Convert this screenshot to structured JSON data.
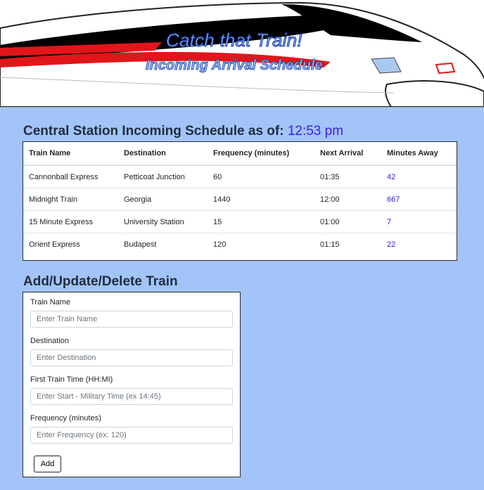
{
  "header": {
    "title": "Catch that Train!",
    "subtitle": "Incoming Arrival Schedule"
  },
  "schedule": {
    "heading": "Central Station Incoming Schedule as of:",
    "current_time": "12:53 pm",
    "columns": [
      "Train Name",
      "Destination",
      "Frequency (minutes)",
      "Next Arrival",
      "Minutes Away"
    ],
    "rows": [
      [
        "Cannonball Express",
        "Petticoat Junction",
        "60",
        "01:35",
        "42"
      ],
      [
        "Midnight Train",
        "Georgia",
        "1440",
        "12:00",
        "667"
      ],
      [
        "15 Minute Express",
        "University Station",
        "15",
        "01:00",
        "7"
      ],
      [
        "Orient Express",
        "Budapest",
        "120",
        "01:15",
        "22"
      ]
    ]
  },
  "form": {
    "heading": "Add/Update/Delete Train",
    "train_name_label": "Train Name",
    "train_name_placeholder": "Enter Train Name",
    "destination_label": "Destination",
    "destination_placeholder": "Enter Destination",
    "first_time_label": "First Train Time (HH:MI)",
    "first_time_placeholder": "Enter Start - Military Time (ex 14:45)",
    "frequency_label": "Frequency (minutes)",
    "frequency_placeholder": "Enter Frequency (ex: 120)",
    "add_label": "Add"
  },
  "colors": {
    "page_background": "#a3c4f9",
    "time_color": "#3a1cf0",
    "train_stripe": "#e0161b"
  }
}
